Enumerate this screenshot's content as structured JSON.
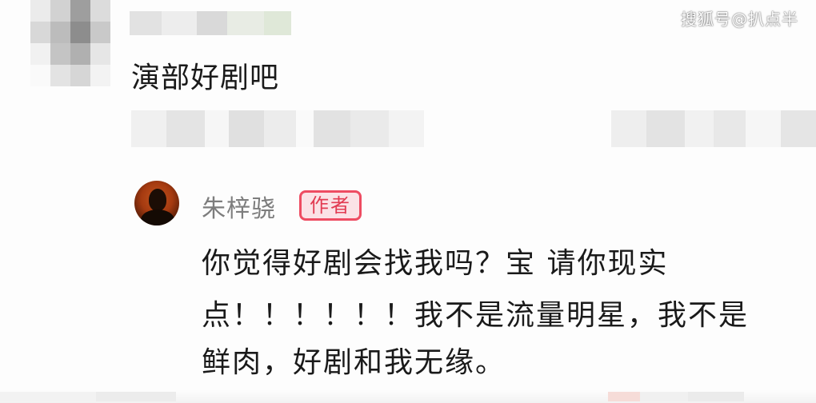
{
  "watermark": "搜狐号@扒点半",
  "comment": {
    "text": "演部好剧吧"
  },
  "reply": {
    "author": "朱梓骁",
    "badge": "作者",
    "lines": [
      "你觉得好剧会找我吗？宝 请你现实",
      "点！！！！！！我不是流量明星，我不是",
      "鲜肉，好剧和我无缘。"
    ]
  },
  "colors": {
    "badge_border": "#ee4c62",
    "badge_bg": "#fbe2e6",
    "badge_text": "#e23b52",
    "author_text": "#7d7d7d",
    "body_text": "#1a1a1a"
  }
}
